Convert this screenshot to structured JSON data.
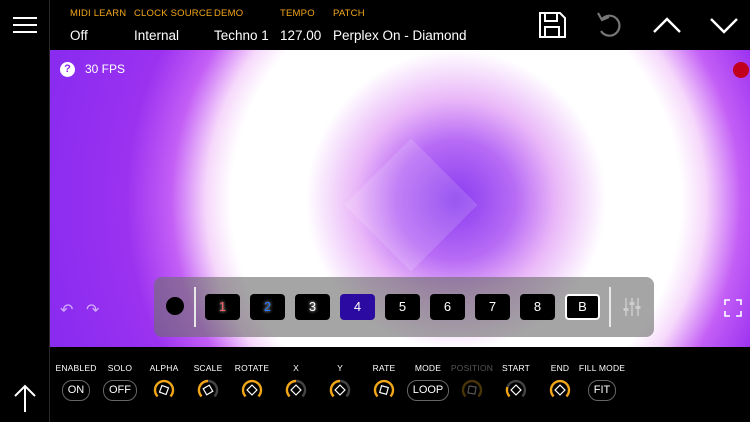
{
  "topbar": {
    "params": [
      {
        "label": "MIDI LEARN",
        "value": "Off"
      },
      {
        "label": "CLOCK SOURCE",
        "value": "Internal"
      },
      {
        "label": "DEMO",
        "value": "Techno 1"
      },
      {
        "label": "TEMPO",
        "value": "127.00"
      },
      {
        "label": "PATCH",
        "value": "Perplex On - Diamond"
      }
    ]
  },
  "canvas": {
    "help": "?",
    "fps": "30 FPS"
  },
  "layers": {
    "slots": [
      "1",
      "2",
      "3",
      "4",
      "5",
      "6",
      "7",
      "8",
      "B"
    ],
    "selected": "4"
  },
  "controls": [
    {
      "label": "ENABLED",
      "type": "toggle",
      "value": "ON"
    },
    {
      "label": "SOLO",
      "type": "toggle",
      "value": "OFF"
    },
    {
      "label": "ALPHA",
      "type": "knob"
    },
    {
      "label": "SCALE",
      "type": "knob"
    },
    {
      "label": "ROTATE",
      "type": "knob"
    },
    {
      "label": "X",
      "type": "knob"
    },
    {
      "label": "Y",
      "type": "knob"
    },
    {
      "label": "RATE",
      "type": "knob"
    },
    {
      "label": "MODE",
      "type": "toggle",
      "value": "LOOP"
    },
    {
      "label": "POSITION",
      "type": "knob",
      "disabled": true
    },
    {
      "label": "START",
      "type": "knob"
    },
    {
      "label": "END",
      "type": "knob"
    },
    {
      "label": "FILL MODE",
      "type": "toggle",
      "value": "FIT"
    }
  ],
  "colors": {
    "accent": "#f2a618",
    "canvas": "#8a2bf0",
    "selected_layer": "#2a0aa0",
    "record": "#c0001c"
  }
}
